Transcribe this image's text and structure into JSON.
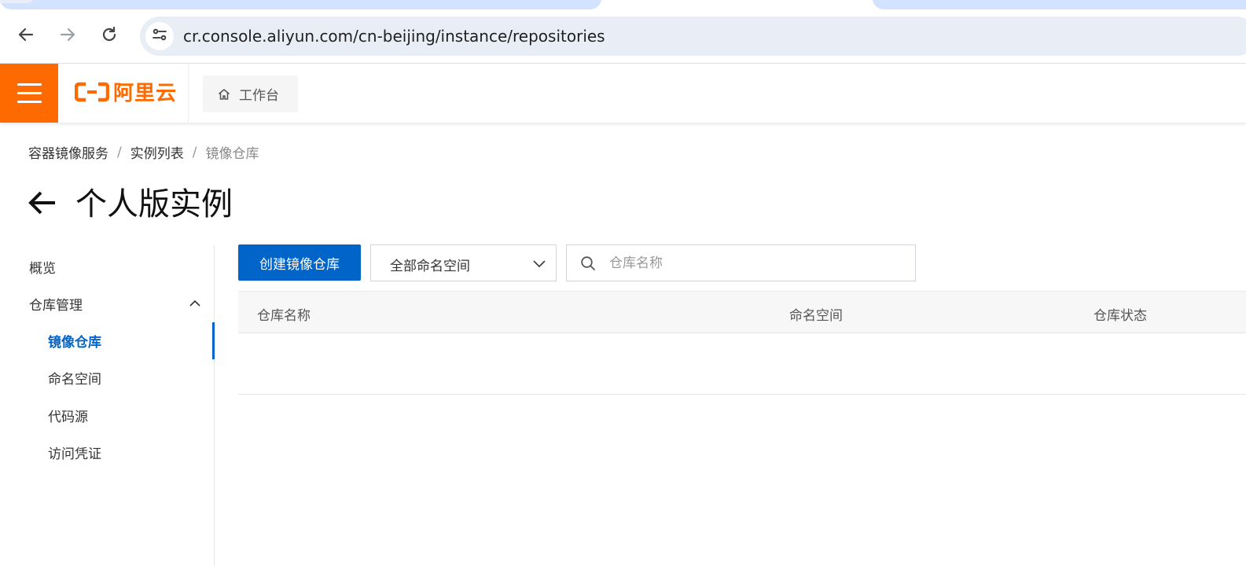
{
  "browser": {
    "url": "cr.console.aliyun.com/cn-beijing/instance/repositories",
    "icons": [
      "back-arrow-icon",
      "forward-arrow-icon",
      "reload-icon",
      "site-info-icon"
    ]
  },
  "topbar": {
    "brand": "阿里云",
    "workbench_label": "工作台",
    "accent_color": "#ff6a00"
  },
  "breadcrumb": [
    {
      "label": "容器镜像服务"
    },
    {
      "label": "实例列表"
    },
    {
      "label": "镜像仓库"
    }
  ],
  "breadcrumb_separator": "/",
  "page": {
    "title": "个人版实例"
  },
  "sidebar": {
    "items": [
      {
        "label": "概览",
        "level": 1
      },
      {
        "label": "仓库管理",
        "level": 1,
        "expanded": true
      },
      {
        "label": "镜像仓库",
        "level": 2,
        "active": true
      },
      {
        "label": "命名空间",
        "level": 2
      },
      {
        "label": "代码源",
        "level": 2
      },
      {
        "label": "访问凭证",
        "level": 2
      }
    ],
    "active_color": "#0064c8"
  },
  "toolbar": {
    "create_label": "创建镜像仓库",
    "namespace_selected": "全部命名空间",
    "search_placeholder": "仓库名称"
  },
  "table": {
    "columns": [
      "仓库名称",
      "命名空间",
      "仓库状态"
    ],
    "rows": []
  }
}
